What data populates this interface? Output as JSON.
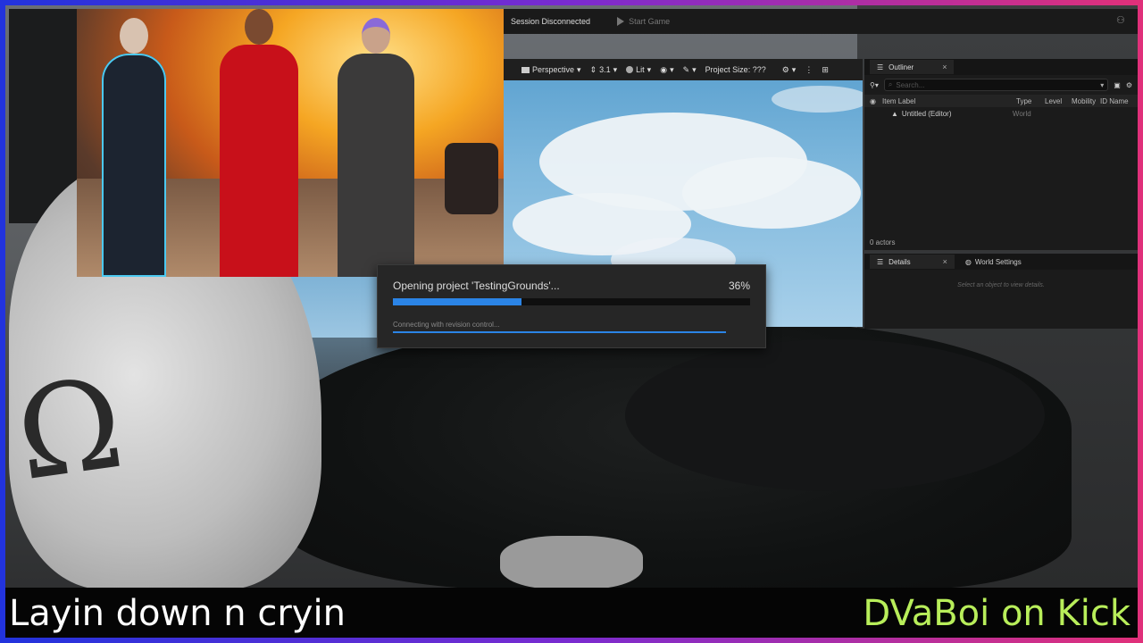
{
  "editor": {
    "top_bar": {
      "session_status": "Session Disconnected",
      "start_game": "Start Game"
    },
    "viewport_toolbar": {
      "perspective": "Perspective",
      "scale": "3.1",
      "lit": "Lit",
      "project_size": "Project Size: ???"
    },
    "outliner": {
      "tab_label": "Outliner",
      "search_placeholder": "Search...",
      "columns": [
        "Item Label",
        "Type",
        "Level",
        "Mobility",
        "ID Name"
      ],
      "rows": [
        {
          "label": "Untitled (Editor)",
          "type": "World"
        }
      ],
      "actor_count": "0 actors"
    },
    "details": {
      "tab_label": "Details",
      "world_settings_tab": "World Settings",
      "hint": "Select an object to view details."
    }
  },
  "dialog": {
    "title": "Opening project 'TestingGrounds'...",
    "percent_label": "36%",
    "progress": 0.36,
    "status": "Connecting with revision control..."
  },
  "stream": {
    "caption_left": "Layin down n cryin",
    "caption_right": "DVaBoi on Kick",
    "caption_right_color": "#b8ee5a"
  }
}
